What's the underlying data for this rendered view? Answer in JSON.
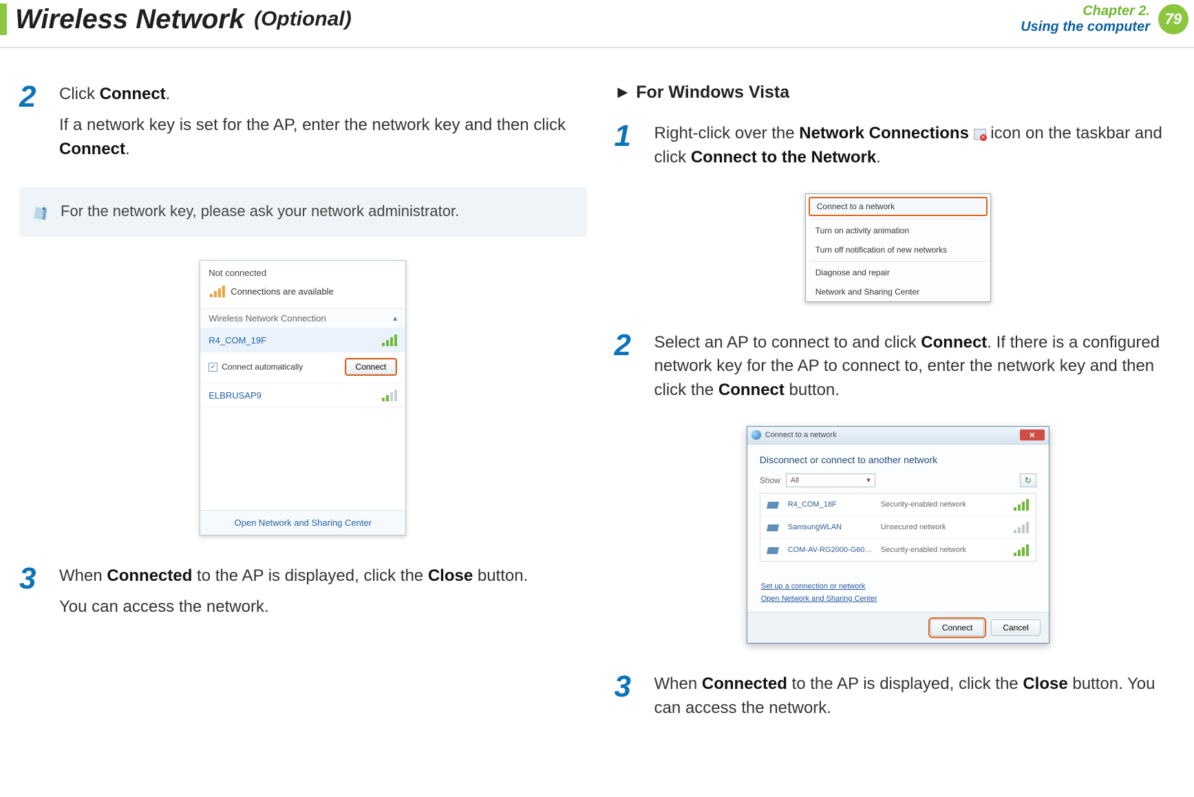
{
  "header": {
    "title": "Wireless Network",
    "subtitle": "(Optional)",
    "chapter_line1": "Chapter 2.",
    "chapter_line2": "Using the computer",
    "page_number": "79"
  },
  "left": {
    "step2_num": "2",
    "step2_p1_a": "Click ",
    "step2_p1_b": "Connect",
    "step2_p1_c": ".",
    "step2_p2_a": "If a network key is set for the AP, enter the network key and then click ",
    "step2_p2_b": "Connect",
    "step2_p2_c": ".",
    "note": "For the network key, please ask your network administrator.",
    "win7": {
      "not_connected": "Not connected",
      "connections_available": "Connections are available",
      "group_title": "Wireless Network Connection",
      "ap1": "R4_COM_19F",
      "auto_label": "Connect automatically",
      "connect_btn": "Connect",
      "ap2": "ELBRUSAP9",
      "footer_link": "Open Network and Sharing Center"
    },
    "step3_num": "3",
    "step3_p1_a": "When ",
    "step3_p1_b": "Connected",
    "step3_p1_c": " to the AP is displayed, click the ",
    "step3_p1_d": "Close",
    "step3_p1_e": " button.",
    "step3_p2": "You can access the network."
  },
  "right": {
    "subheading": "For Windows Vista",
    "step1_num": "1",
    "step1_p1_a": "Right-click over the ",
    "step1_p1_b": "Network Connections",
    "step1_p1_c": " icon on the taskbar and click ",
    "step1_p1_d": "Connect to the Network",
    "step1_p1_e": ".",
    "menu": {
      "m1": "Connect to a network",
      "m2": "Turn on activity animation",
      "m3": "Turn off notification of new networks",
      "m4": "Diagnose and repair",
      "m5": "Network and Sharing Center"
    },
    "step2_num": "2",
    "step2_p_a": "Select an AP to connect to and click ",
    "step2_p_b": "Connect",
    "step2_p_c": ". If there is a configured network key for the AP to connect to, enter the network key and then click the ",
    "step2_p_d": "Connect",
    "step2_p_e": " button.",
    "window": {
      "title_icon": "Connect to a network",
      "prompt": "Disconnect or connect to another network",
      "show_label": "Show",
      "dd_value": "All",
      "row1_name": "R4_COM_18F",
      "row1_type": "Security-enabled network",
      "row2_name": "SamsungWLAN",
      "row2_type": "Unsecured network",
      "row3_name": "COM-AV-RG2000-G60…",
      "row3_type": "Security-enabled network",
      "link1": "Set up a connection or network",
      "link2": "Open Network and Sharing Center",
      "btn_connect": "Connect",
      "btn_cancel": "Cancel"
    },
    "step3_num": "3",
    "step3_p_a": "When ",
    "step3_p_b": "Connected",
    "step3_p_c": " to the AP is displayed, click the ",
    "step3_p_d": "Close",
    "step3_p_e": " button. You can access the network."
  }
}
